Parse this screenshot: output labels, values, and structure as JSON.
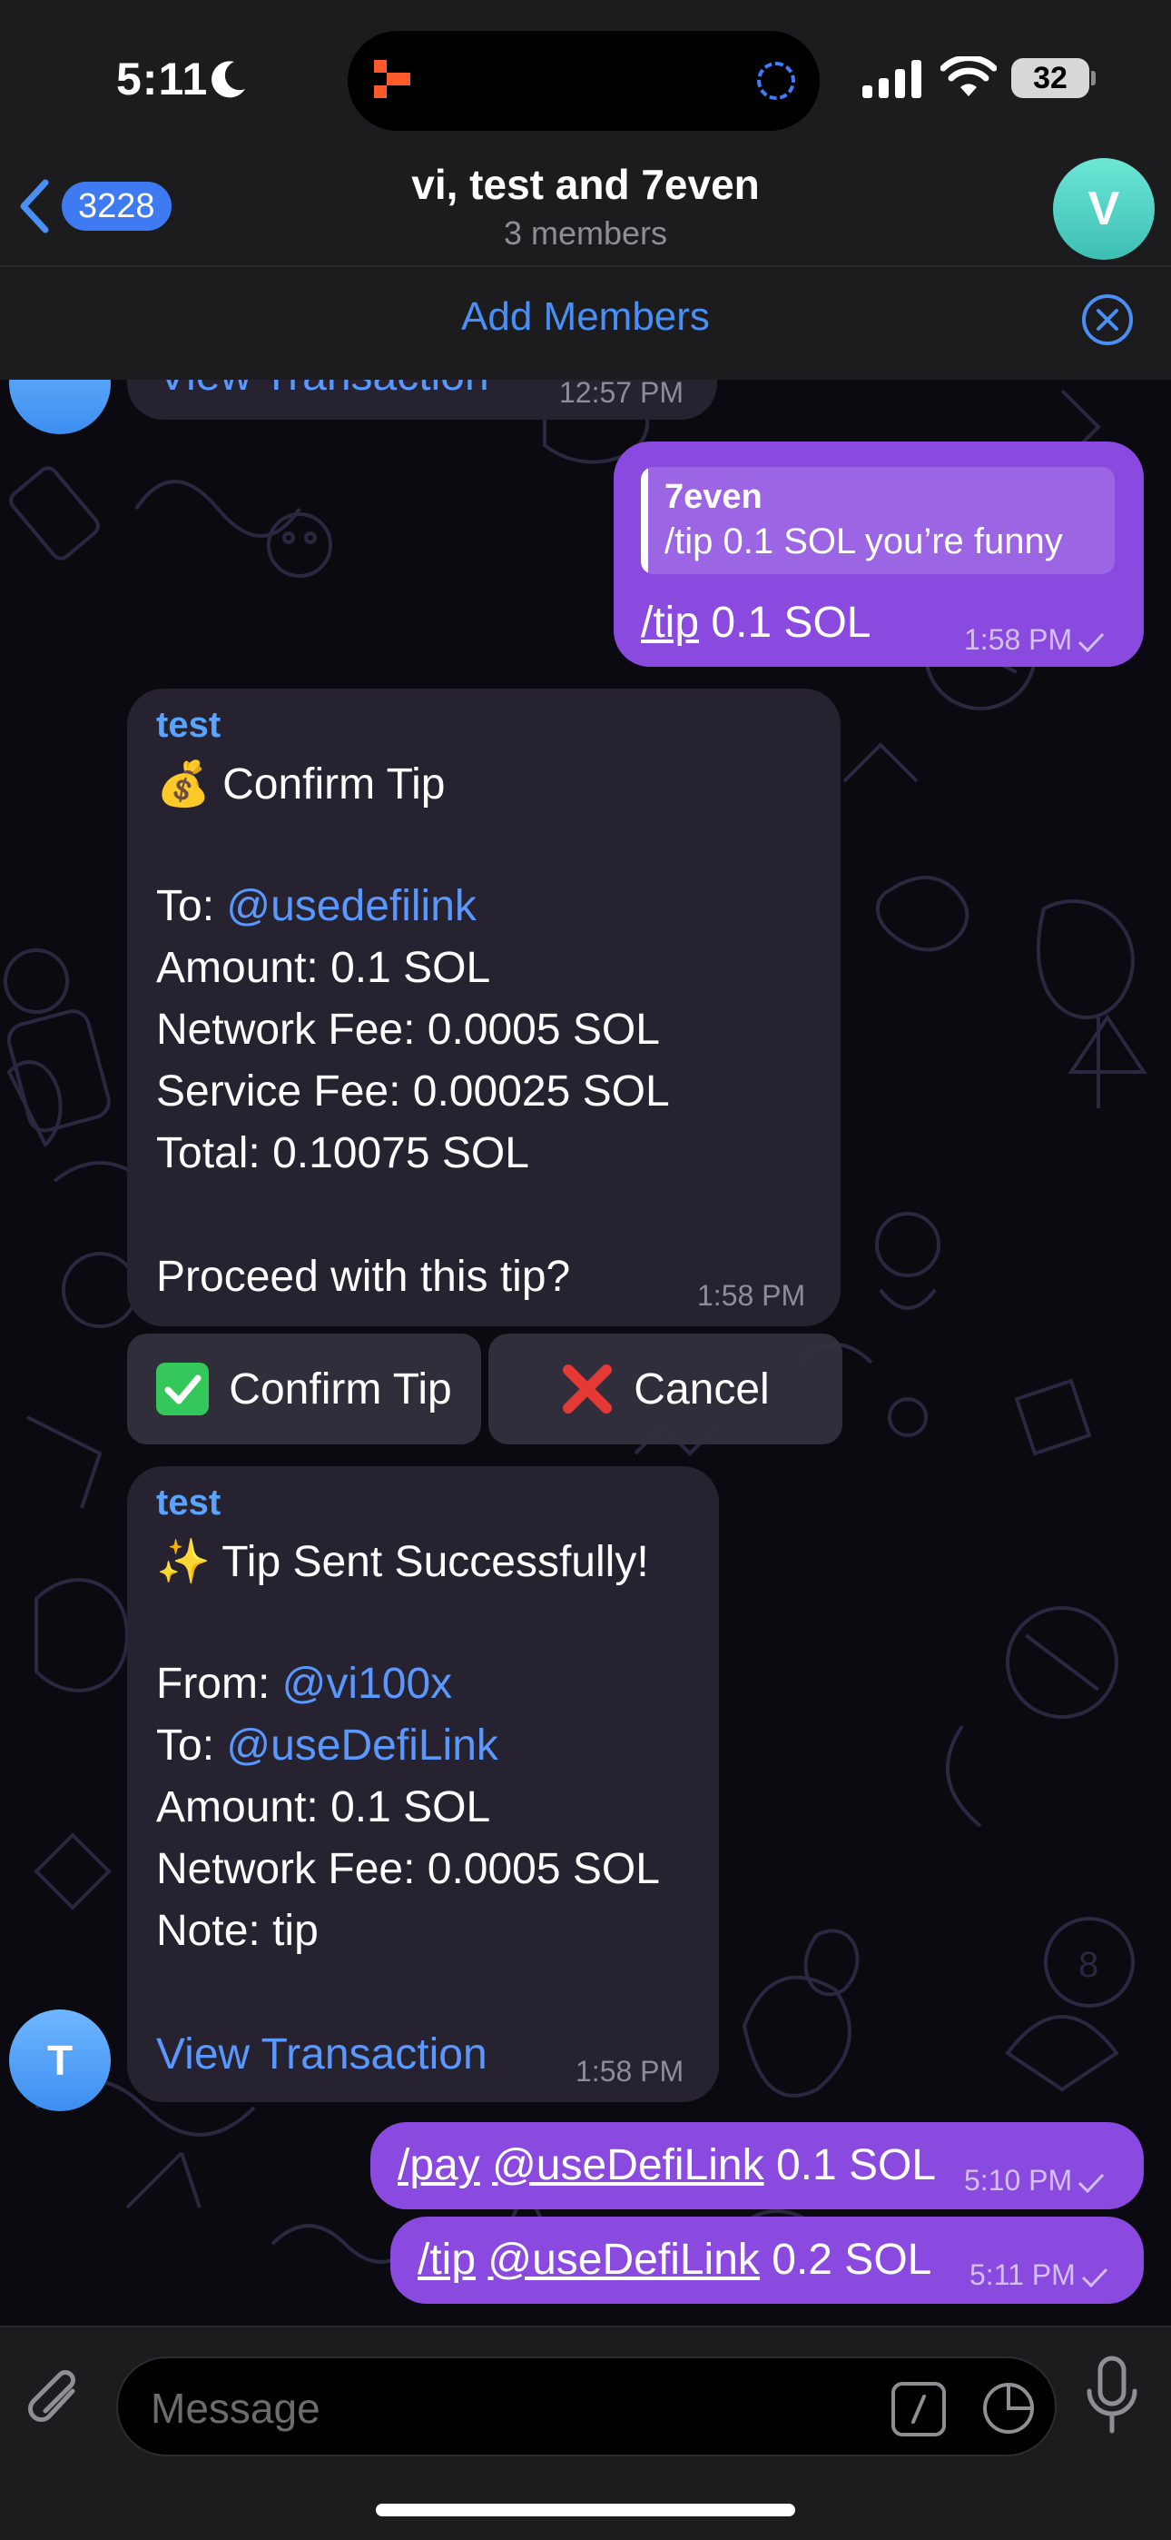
{
  "status_bar": {
    "time": "5:11",
    "battery": "32"
  },
  "header": {
    "back_count": "3228",
    "title": "vi, test and 7even",
    "subtitle": "3 members",
    "avatar_letter": "V"
  },
  "add_members": {
    "label": "Add Members"
  },
  "messages": {
    "prev_partial": {
      "text": "View Transaction",
      "time": "12:57 PM"
    },
    "out_reply": {
      "reply_name": "7even",
      "reply_text": "/tip 0.1 SOL you’re funny",
      "cmd": "/tip",
      "rest": " 0.1 SOL",
      "time": "1:58 PM"
    },
    "confirm": {
      "sender": "test",
      "title": "💰 Confirm Tip",
      "to_label": "To: ",
      "to_handle": "@usedefilink",
      "amount": "Amount: 0.1 SOL",
      "network_fee": "Network Fee: 0.0005 SOL",
      "service_fee": "Service Fee: 0.00025 SOL",
      "total": "Total: 0.10075 SOL",
      "question": "Proceed with this tip?",
      "time": "1:58 PM"
    },
    "buttons": {
      "confirm": "Confirm Tip",
      "cancel": "Cancel"
    },
    "sent": {
      "sender": "test",
      "title": "✨ Tip Sent Successfully!",
      "from_label": "From: ",
      "from_handle": "@vi100x",
      "to_label": "To: ",
      "to_handle": "@useDefiLink",
      "amount": "Amount: 0.1 SOL",
      "network_fee": "Network Fee: 0.0005 SOL",
      "note": "Note: tip",
      "view_tx": "View Transaction",
      "time": "1:58 PM",
      "avatar_letter": "T"
    },
    "pay": {
      "cmd": "/pay",
      "handle": "@useDefiLink",
      "rest": " 0.1 SOL",
      "time": "5:10 PM"
    },
    "tip": {
      "cmd": "/tip",
      "handle": "@useDefiLink",
      "rest": " 0.2 SOL",
      "time": "5:11 PM"
    }
  },
  "input": {
    "placeholder": "Message"
  },
  "colors": {
    "accent": "#4a8ff5",
    "outgoing": "#8a4ae0",
    "incoming": "#272332",
    "link": "#5a98ff"
  }
}
